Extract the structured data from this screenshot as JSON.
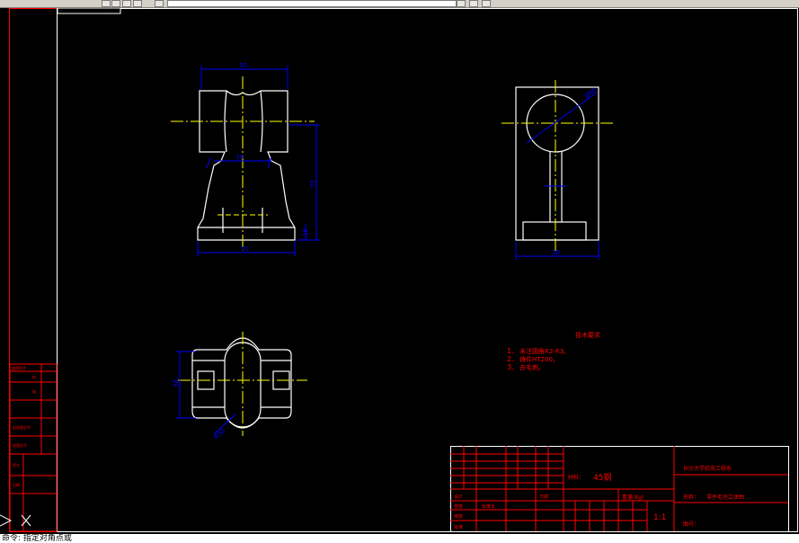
{
  "toolbar": {
    "buttons": [
      "grid-icon",
      "layer-icon",
      "bulb-icon",
      "sun-icon",
      "lock-icon",
      "color-square-icon"
    ]
  },
  "drawing": {
    "dimensions": {
      "front_width": "50",
      "front_inner": "30",
      "front_height": "72",
      "front_base_h": "16",
      "front_base_w": "70",
      "side_dia": "Ø40",
      "side_width": "30",
      "top_height": "38",
      "top_radius": "R30"
    },
    "tech_notes": {
      "title": "技术要求",
      "items": [
        {
          "num": "1．",
          "text": "未注圆角R2-R3。"
        },
        {
          "num": "2．",
          "text": "铸件HT200。"
        },
        {
          "num": "3．",
          "text": "去毛刺。"
        }
      ]
    },
    "left_table": {
      "rows": [
        "描图签字",
        "校",
        "描",
        "旧底图总号",
        "底图总号",
        "签字",
        "日期"
      ]
    },
    "title_block": {
      "material_label": "材料：",
      "material_value": "45钢",
      "weight_label": "重量(Kg)",
      "scale": "1:1",
      "company": "长沙大学机电工程系",
      "name_label": "名称：",
      "name_value": "零件毛坯立体图",
      "drawing_no_label": "图号：",
      "designer_label": "设计",
      "checker_label": "校核",
      "review_label": "审核",
      "approve_label": "批准",
      "standard_label": "标准化",
      "date_label": "日期"
    }
  },
  "command_line": {
    "text": "命令: 指定对角点或"
  }
}
